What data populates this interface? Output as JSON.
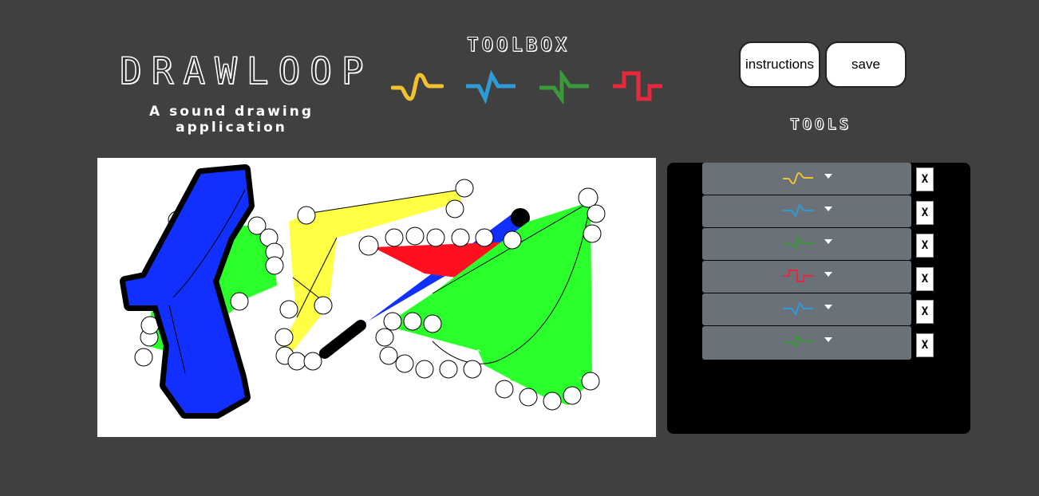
{
  "app": {
    "title": "DRAWLOOP",
    "subtitle": "A sound drawing application"
  },
  "toolbox": {
    "title": "TOOLBOX",
    "tools": [
      {
        "name": "sine-wave-icon",
        "color": "#f2c12e"
      },
      {
        "name": "triangle-wave-icon",
        "color": "#2f9bd6"
      },
      {
        "name": "sawtooth-wave-icon",
        "color": "#3a9a3a"
      },
      {
        "name": "square-wave-icon",
        "color": "#e8283c"
      }
    ]
  },
  "buttons": {
    "instructions": "instructions",
    "save": "save"
  },
  "tools_panel": {
    "title": "TOOLS",
    "delete_label": "X",
    "tracks": [
      {
        "wave": "sine-wave-icon",
        "color": "#f2c12e"
      },
      {
        "wave": "triangle-wave-icon",
        "color": "#2f9bd6"
      },
      {
        "wave": "sawtooth-wave-icon",
        "color": "#3a9a3a"
      },
      {
        "wave": "square-wave-icon",
        "color": "#e8283c"
      },
      {
        "wave": "triangle-wave-icon",
        "color": "#2f9bd6"
      },
      {
        "wave": "sawtooth-wave-icon",
        "color": "#3a9a3a"
      }
    ]
  },
  "canvas": {
    "shape_colors": {
      "blue": "#1130ff",
      "green": "#2bff2b",
      "yellow": "#ffff44",
      "red": "#ff1020"
    }
  }
}
